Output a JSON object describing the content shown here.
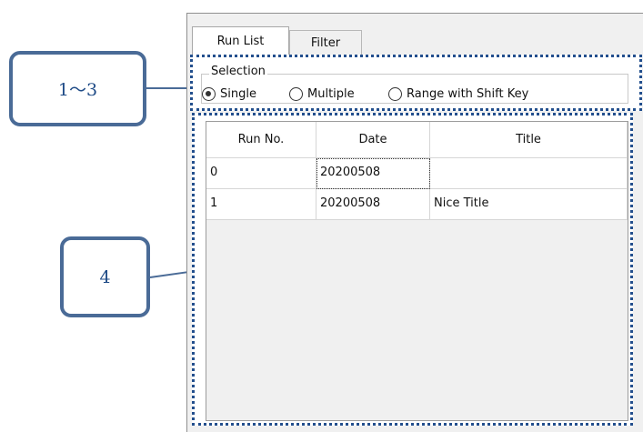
{
  "annotations": {
    "callout_1_3": "1～3",
    "callout_4": "4"
  },
  "tabs": [
    {
      "label": "Run List",
      "active": true
    },
    {
      "label": "Filter",
      "active": false
    }
  ],
  "selection": {
    "title": "Selection",
    "options": [
      {
        "label": "Single",
        "checked": true
      },
      {
        "label": "Multiple",
        "checked": false
      },
      {
        "label": "Range with Shift Key",
        "checked": false
      }
    ]
  },
  "run_table": {
    "columns": [
      "Run No.",
      "Date",
      "Title"
    ],
    "rows": [
      [
        "0",
        "20200508",
        ""
      ],
      [
        "1",
        "20200508",
        "Nice Title"
      ]
    ]
  },
  "colors": {
    "annotation_blue": "#4a6b97",
    "dotted_blue": "#234f8d"
  }
}
